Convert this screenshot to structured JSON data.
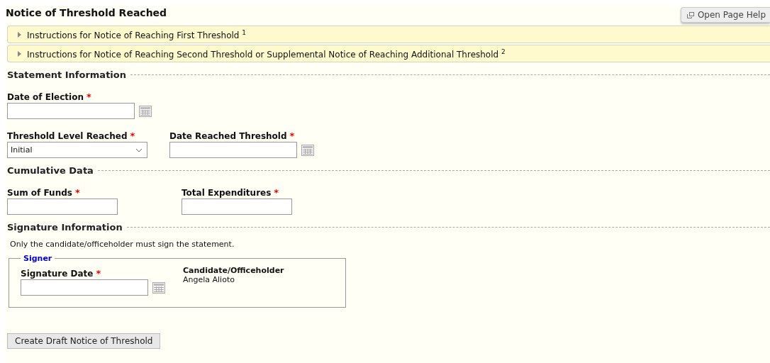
{
  "title": "Notice of Threshold Reached",
  "help_button": {
    "label": "Open Page Help"
  },
  "instructions": [
    {
      "label": "Instructions for Notice of Reaching First Threshold $^{1}$",
      "expanded": false
    },
    {
      "label": "Instructions for Notice of Reaching Second Threshold or Supplemental Notice of Reaching Additional Threshold $^{2}$",
      "expanded": false
    }
  ],
  "sections": [
    {
      "heading": "Statement Information",
      "rows": [
        [
          {
            "kind": "date",
            "label": "Date of Election",
            "required_mark": "*"
          }
        ],
        [
          {
            "kind": "select",
            "label": "Threshold Level Reached",
            "required_mark": "*",
            "value": "Initial"
          },
          {
            "kind": "date",
            "label": "Date Reached Threshold",
            "required_mark": "*"
          }
        ]
      ]
    },
    {
      "heading": "Cumulative Data",
      "rows": [
        [
          {
            "kind": "text",
            "label": "Sum of Funds",
            "required_mark": "*"
          },
          {
            "kind": "text",
            "label": "Total Expenditures",
            "required_mark": "*"
          }
        ]
      ]
    },
    {
      "heading": "Signature Information",
      "note": "Only the candidate/officeholder must sign the statement.",
      "signer": {
        "legend": "Signer",
        "field": {
          "kind": "date",
          "label": "Signature Date",
          "required_mark": "*"
        },
        "role": "Candidate/Officeholder",
        "name": "Angela Alioto"
      }
    }
  ],
  "submit_button": "Create Draft Notice of Threshold"
}
